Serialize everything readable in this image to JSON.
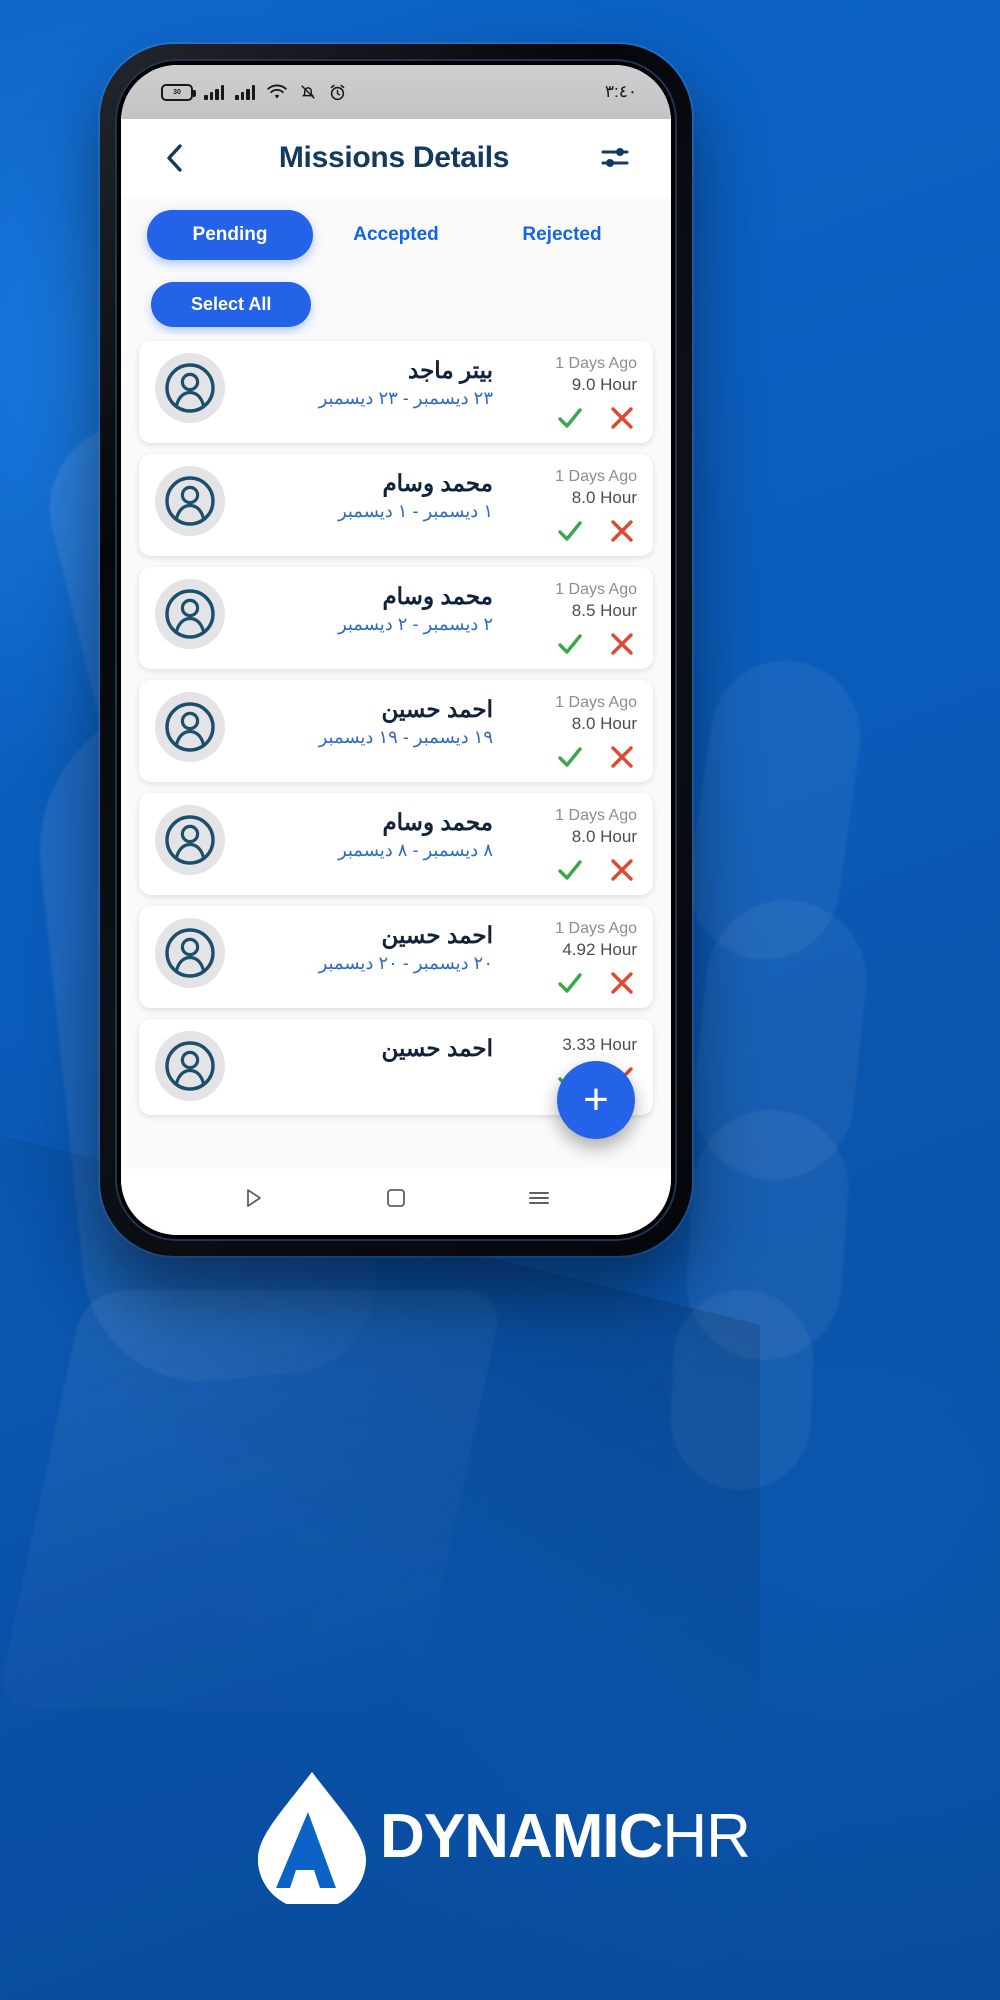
{
  "colors": {
    "brand_blue": "#2463e8",
    "bg_blue": "#0a63c4",
    "title_navy": "#14395f",
    "link_blue": "#2f6bc4",
    "approve_green": "#3aa84a",
    "reject_red": "#e0482f"
  },
  "status_bar": {
    "time": "٣:٤٠",
    "icons": [
      "battery-icon",
      "signal-bars-icon",
      "signal-bars-icon",
      "wifi-icon",
      "bell-off-icon",
      "alarm-icon"
    ]
  },
  "header": {
    "back_icon": "chevron-left-icon",
    "title": "Missions Details",
    "filter_icon": "filter-sliders-icon"
  },
  "tabs": [
    {
      "label": "Pending",
      "active": true
    },
    {
      "label": "Accepted",
      "active": false
    },
    {
      "label": "Rejected",
      "active": false
    }
  ],
  "toolbar": {
    "select_all_label": "Select All"
  },
  "missions": [
    {
      "name": "بيتر ماجد",
      "date_range": "٢٣ ديسمبر - ٢٣ ديسمبر",
      "ago": "1 Days Ago",
      "hours": "9.0  Hour"
    },
    {
      "name": "محمد وسام",
      "date_range": "١ ديسمبر - ١ ديسمبر",
      "ago": "1 Days Ago",
      "hours": "8.0  Hour"
    },
    {
      "name": "محمد وسام",
      "date_range": "٢ ديسمبر - ٢ ديسمبر",
      "ago": "1 Days Ago",
      "hours": "8.5  Hour"
    },
    {
      "name": "احمد حسين",
      "date_range": "١٩ ديسمبر - ١٩ ديسمبر",
      "ago": "1 Days Ago",
      "hours": "8.0  Hour"
    },
    {
      "name": "محمد وسام",
      "date_range": "٨ ديسمبر - ٨ ديسمبر",
      "ago": "1 Days Ago",
      "hours": "8.0  Hour"
    },
    {
      "name": "احمد حسين",
      "date_range": "٢٠ ديسمبر - ٢٠ ديسمبر",
      "ago": "1 Days Ago",
      "hours": "4.92  Hour"
    },
    {
      "name": "احمد حسين",
      "date_range": "",
      "ago": "",
      "hours": "3.33  Hour"
    }
  ],
  "row_actions": {
    "approve_icon": "check-icon",
    "reject_icon": "x-icon"
  },
  "fab": {
    "label": "+",
    "icon": "plus-icon"
  },
  "nav_bar": {
    "back_icon": "triangle-back-icon",
    "home_icon": "square-home-icon",
    "recents_icon": "menu-lines-icon"
  },
  "brand": {
    "logo_icon": "dynamic-hr-droplet-logo",
    "name_bold": "DYNAMIC",
    "name_thin": "HR"
  }
}
